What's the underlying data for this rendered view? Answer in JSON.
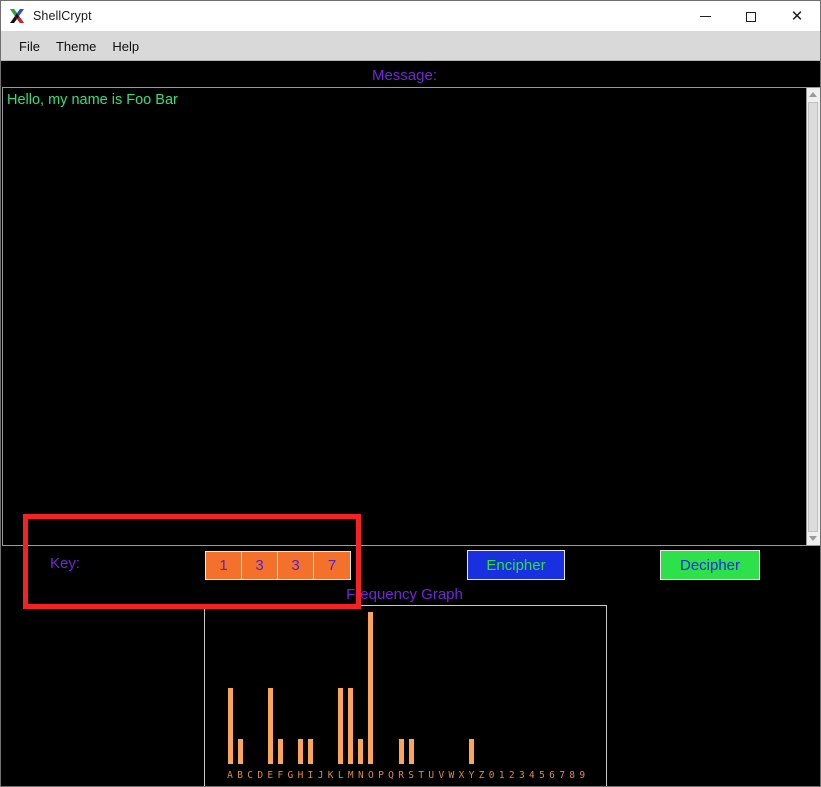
{
  "window": {
    "title": "ShellCrypt",
    "icon": "x11-logo-icon",
    "controls": {
      "minimize": "—",
      "maximize": "□",
      "close": "✕"
    }
  },
  "menubar": {
    "items": [
      {
        "label": "File"
      },
      {
        "label": "Theme"
      },
      {
        "label": "Help"
      }
    ]
  },
  "message": {
    "label": "Message:",
    "value": "Hello, my name is Foo Bar",
    "text_color": "#2ee07a",
    "label_color": "#7722dd"
  },
  "key": {
    "label": "Key:",
    "digits": [
      "1",
      "3",
      "3",
      "7"
    ],
    "cell_bg": "#f4712c",
    "digit_color": "#5522cc"
  },
  "actions": {
    "encipher": "Encipher",
    "decipher": "Decipher",
    "encipher_bg": "#1830e0",
    "encipher_fg": "#2ee03c",
    "decipher_bg": "#2ee04a",
    "decipher_fg": "#1830e0"
  },
  "graph": {
    "title": "Frequency Graph",
    "bar_color": "#faa55a",
    "label_color": "#e08a3c"
  },
  "highlight": {
    "color": "#f52222",
    "target": "key-entry-row"
  },
  "chart_data": {
    "type": "bar",
    "title": "Frequency Graph",
    "xlabel": "",
    "ylabel": "",
    "grid": false,
    "ylim": [
      0,
      6
    ],
    "categories": [
      "A",
      "B",
      "C",
      "D",
      "E",
      "F",
      "G",
      "H",
      "I",
      "J",
      "K",
      "L",
      "M",
      "N",
      "O",
      "P",
      "Q",
      "R",
      "S",
      "T",
      "U",
      "V",
      "W",
      "X",
      "Y",
      "Z",
      "0",
      "1",
      "2",
      "3",
      "4",
      "5",
      "6",
      "7",
      "8",
      "9"
    ],
    "values": [
      3,
      1,
      0,
      0,
      3,
      1,
      0,
      1,
      1,
      0,
      0,
      3,
      3,
      1,
      6,
      0,
      0,
      1,
      1,
      0,
      0,
      0,
      0,
      0,
      1,
      0,
      0,
      0,
      0,
      0,
      0,
      0,
      0,
      0,
      0,
      0
    ]
  }
}
